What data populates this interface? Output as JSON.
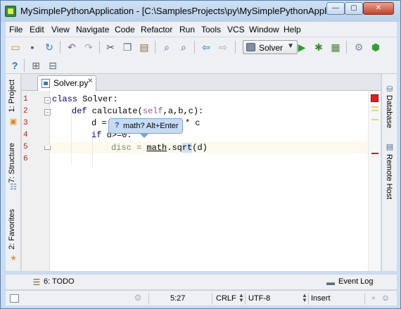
{
  "window": {
    "title": "MySimplePythonApplication - [C:\\SamplesProjects\\py\\MySimplePythonApplicat...",
    "minimize": "—",
    "maximize": "▢",
    "close": "✕"
  },
  "menu": [
    "File",
    "Edit",
    "View",
    "Navigate",
    "Code",
    "Refactor",
    "Run",
    "Tools",
    "VCS",
    "Window",
    "Help"
  ],
  "toolbar": {
    "run_config": "Solver",
    "icons": [
      "open-folder-icon",
      "save-icon",
      "sync-icon",
      "undo-icon",
      "redo-icon",
      "cut-icon",
      "copy-icon",
      "paste-icon",
      "find-icon",
      "replace-icon",
      "back-icon",
      "forward-icon",
      "run-icon",
      "debug-icon",
      "coverage-icon",
      "settings-icon",
      "python-console-icon",
      "help-icon",
      "sdk-icon",
      "vcs-icon"
    ]
  },
  "left_stripe": {
    "project": "1: Project",
    "structure": "7: Structure",
    "favorites": "2: Favorites"
  },
  "right_stripe": {
    "database": "Database",
    "remote_host": "Remote Host"
  },
  "editor": {
    "tab_label": "Solver.py",
    "line_numbers": [
      "1",
      "2",
      "3",
      "4",
      "5",
      "6"
    ],
    "code": {
      "l1_kw": "class",
      "l1_rest": " Solver:",
      "l2_kw": "def",
      "l2_name": " calculate(",
      "l2_self": "self",
      "l2_rest": ",a,b,c):",
      "l3_start": "d = ",
      "l3_end": "* c",
      "l4_kw": "if",
      "l4_rest": " d>=0:",
      "l5_var": "disc = ",
      "l5_mod": "math",
      "l5_dot": ".",
      "l5_func_a": "sq",
      "l5_func_b": "rt",
      "l5_rest": "(d)"
    },
    "hint": {
      "icon": "?",
      "text": "math? Alt+Enter"
    }
  },
  "bottom_tools": {
    "todo": "6: TODO",
    "event_log": "Event Log"
  },
  "status": {
    "position": "5:27",
    "line_separator": "CRLF",
    "encoding": "UTF-8",
    "insert_mode": "Insert"
  },
  "colors": {
    "keyword": "#000080",
    "self": "#94558d",
    "error": "#e41b1b",
    "current_line": "#fcfaed"
  }
}
